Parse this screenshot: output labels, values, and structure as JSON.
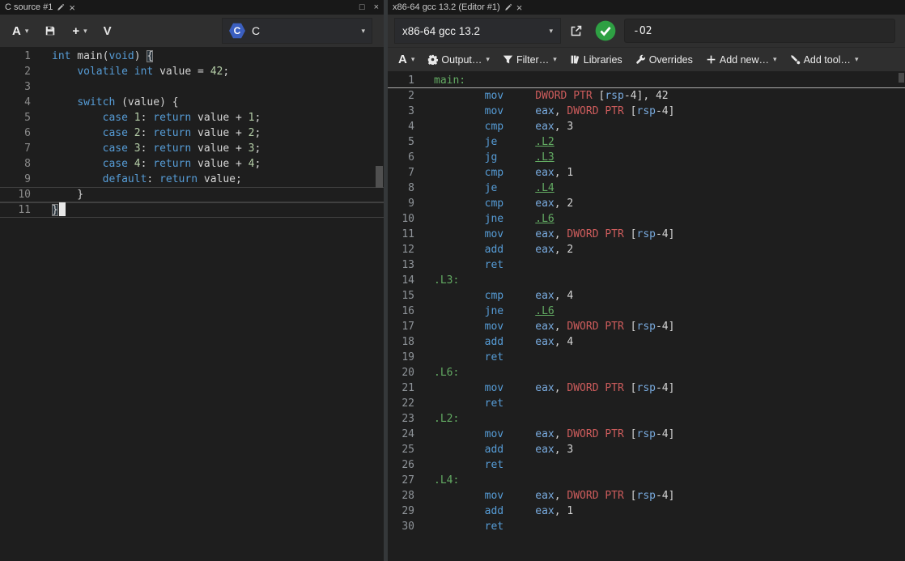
{
  "source_pane": {
    "tab": {
      "title": "C source #1",
      "close_glyph": "×",
      "maximize_glyph": "□"
    },
    "toolbar": {
      "font_label": "A",
      "add_label": "+",
      "vim_label": "V",
      "language_label": "C",
      "language_logo_letter": "C"
    },
    "code_lines": [
      {
        "n": "1",
        "tokens": [
          [
            "kw",
            "int"
          ],
          [
            "pl",
            " main("
          ],
          [
            "kw",
            "void"
          ],
          [
            "pl",
            ") "
          ],
          [
            "bh",
            "{"
          ]
        ]
      },
      {
        "n": "2",
        "tokens": [
          [
            "pl",
            "    "
          ],
          [
            "kw",
            "volatile"
          ],
          [
            "pl",
            " "
          ],
          [
            "kw",
            "int"
          ],
          [
            "pl",
            " value = "
          ],
          [
            "num",
            "42"
          ],
          [
            "pl",
            ";"
          ]
        ]
      },
      {
        "n": "3",
        "tokens": []
      },
      {
        "n": "4",
        "tokens": [
          [
            "pl",
            "    "
          ],
          [
            "kw",
            "switch"
          ],
          [
            "pl",
            " (value) {"
          ]
        ]
      },
      {
        "n": "5",
        "tokens": [
          [
            "pl",
            "        "
          ],
          [
            "kw",
            "case"
          ],
          [
            "pl",
            " "
          ],
          [
            "num",
            "1"
          ],
          [
            "pl",
            ": "
          ],
          [
            "kw",
            "return"
          ],
          [
            "pl",
            " value + "
          ],
          [
            "num",
            "1"
          ],
          [
            "pl",
            ";"
          ]
        ]
      },
      {
        "n": "6",
        "tokens": [
          [
            "pl",
            "        "
          ],
          [
            "kw",
            "case"
          ],
          [
            "pl",
            " "
          ],
          [
            "num",
            "2"
          ],
          [
            "pl",
            ": "
          ],
          [
            "kw",
            "return"
          ],
          [
            "pl",
            " value + "
          ],
          [
            "num",
            "2"
          ],
          [
            "pl",
            ";"
          ]
        ]
      },
      {
        "n": "7",
        "tokens": [
          [
            "pl",
            "        "
          ],
          [
            "kw",
            "case"
          ],
          [
            "pl",
            " "
          ],
          [
            "num",
            "3"
          ],
          [
            "pl",
            ": "
          ],
          [
            "kw",
            "return"
          ],
          [
            "pl",
            " value + "
          ],
          [
            "num",
            "3"
          ],
          [
            "pl",
            ";"
          ]
        ]
      },
      {
        "n": "8",
        "tokens": [
          [
            "pl",
            "        "
          ],
          [
            "kw",
            "case"
          ],
          [
            "pl",
            " "
          ],
          [
            "num",
            "4"
          ],
          [
            "pl",
            ": "
          ],
          [
            "kw",
            "return"
          ],
          [
            "pl",
            " value + "
          ],
          [
            "num",
            "4"
          ],
          [
            "pl",
            ";"
          ]
        ]
      },
      {
        "n": "9",
        "tokens": [
          [
            "pl",
            "        "
          ],
          [
            "kw",
            "default"
          ],
          [
            "pl",
            ": "
          ],
          [
            "kw",
            "return"
          ],
          [
            "pl",
            " value;"
          ]
        ]
      },
      {
        "n": "10",
        "cls": "hl",
        "tokens": [
          [
            "pl",
            "    }"
          ]
        ]
      },
      {
        "n": "11",
        "cls": "hl",
        "caret": true,
        "tokens": [
          [
            "bh",
            "}"
          ]
        ]
      }
    ]
  },
  "compiler_pane": {
    "tab": {
      "title": "x86-64 gcc 13.2 (Editor #1)",
      "close_glyph": "×"
    },
    "toolbar": {
      "compiler_name": "x86-64 gcc 13.2",
      "options_value": "-O2",
      "status": "success"
    },
    "toolbar2": [
      {
        "name": "font-size-button",
        "icon": null,
        "label": "A",
        "big": true,
        "caret": true
      },
      {
        "name": "output-button",
        "icon": "gear",
        "label": "Output…",
        "big": false,
        "caret": true
      },
      {
        "name": "filter-button",
        "icon": "filter",
        "label": "Filter…",
        "big": false,
        "caret": true
      },
      {
        "name": "libraries-button",
        "icon": "book",
        "label": "Libraries",
        "big": false,
        "caret": false
      },
      {
        "name": "overrides-button",
        "icon": "wrench",
        "label": "Overrides",
        "big": false,
        "caret": false
      },
      {
        "name": "add-new-button",
        "icon": "plus",
        "label": "Add new…",
        "big": false,
        "caret": true
      },
      {
        "name": "add-tool-button",
        "icon": "tool",
        "label": "Add tool…",
        "big": false,
        "caret": true
      }
    ],
    "asm_lines": [
      {
        "n": "1",
        "cls": "hlb",
        "tokens": [
          [
            "lbl",
            "main:"
          ]
        ]
      },
      {
        "n": "2",
        "tokens": [
          [
            "pl",
            "        "
          ],
          [
            "mn",
            "mov"
          ],
          [
            "pl",
            "     "
          ],
          [
            "ptr",
            "DWORD PTR"
          ],
          [
            "pl",
            " ["
          ],
          [
            "reg",
            "rsp"
          ],
          [
            "pl",
            "-4], 42"
          ]
        ]
      },
      {
        "n": "3",
        "tokens": [
          [
            "pl",
            "        "
          ],
          [
            "mn",
            "mov"
          ],
          [
            "pl",
            "     "
          ],
          [
            "reg",
            "eax"
          ],
          [
            "pl",
            ", "
          ],
          [
            "ptr",
            "DWORD PTR"
          ],
          [
            "pl",
            " ["
          ],
          [
            "reg",
            "rsp"
          ],
          [
            "pl",
            "-4]"
          ]
        ]
      },
      {
        "n": "4",
        "tokens": [
          [
            "pl",
            "        "
          ],
          [
            "mn",
            "cmp"
          ],
          [
            "pl",
            "     "
          ],
          [
            "reg",
            "eax"
          ],
          [
            "pl",
            ", 3"
          ]
        ]
      },
      {
        "n": "5",
        "tokens": [
          [
            "pl",
            "        "
          ],
          [
            "mn",
            "je"
          ],
          [
            "pl",
            "      "
          ],
          [
            "ref",
            ".L2"
          ]
        ]
      },
      {
        "n": "6",
        "tokens": [
          [
            "pl",
            "        "
          ],
          [
            "mn",
            "jg"
          ],
          [
            "pl",
            "      "
          ],
          [
            "ref",
            ".L3"
          ]
        ]
      },
      {
        "n": "7",
        "tokens": [
          [
            "pl",
            "        "
          ],
          [
            "mn",
            "cmp"
          ],
          [
            "pl",
            "     "
          ],
          [
            "reg",
            "eax"
          ],
          [
            "pl",
            ", 1"
          ]
        ]
      },
      {
        "n": "8",
        "tokens": [
          [
            "pl",
            "        "
          ],
          [
            "mn",
            "je"
          ],
          [
            "pl",
            "      "
          ],
          [
            "ref",
            ".L4"
          ]
        ]
      },
      {
        "n": "9",
        "tokens": [
          [
            "pl",
            "        "
          ],
          [
            "mn",
            "cmp"
          ],
          [
            "pl",
            "     "
          ],
          [
            "reg",
            "eax"
          ],
          [
            "pl",
            ", 2"
          ]
        ]
      },
      {
        "n": "10",
        "tokens": [
          [
            "pl",
            "        "
          ],
          [
            "mn",
            "jne"
          ],
          [
            "pl",
            "     "
          ],
          [
            "ref",
            ".L6"
          ]
        ]
      },
      {
        "n": "11",
        "tokens": [
          [
            "pl",
            "        "
          ],
          [
            "mn",
            "mov"
          ],
          [
            "pl",
            "     "
          ],
          [
            "reg",
            "eax"
          ],
          [
            "pl",
            ", "
          ],
          [
            "ptr",
            "DWORD PTR"
          ],
          [
            "pl",
            " ["
          ],
          [
            "reg",
            "rsp"
          ],
          [
            "pl",
            "-4]"
          ]
        ]
      },
      {
        "n": "12",
        "tokens": [
          [
            "pl",
            "        "
          ],
          [
            "mn",
            "add"
          ],
          [
            "pl",
            "     "
          ],
          [
            "reg",
            "eax"
          ],
          [
            "pl",
            ", 2"
          ]
        ]
      },
      {
        "n": "13",
        "tokens": [
          [
            "pl",
            "        "
          ],
          [
            "mn",
            "ret"
          ]
        ]
      },
      {
        "n": "14",
        "tokens": [
          [
            "lbl",
            ".L3:"
          ]
        ]
      },
      {
        "n": "15",
        "tokens": [
          [
            "pl",
            "        "
          ],
          [
            "mn",
            "cmp"
          ],
          [
            "pl",
            "     "
          ],
          [
            "reg",
            "eax"
          ],
          [
            "pl",
            ", 4"
          ]
        ]
      },
      {
        "n": "16",
        "tokens": [
          [
            "pl",
            "        "
          ],
          [
            "mn",
            "jne"
          ],
          [
            "pl",
            "     "
          ],
          [
            "ref",
            ".L6"
          ]
        ]
      },
      {
        "n": "17",
        "tokens": [
          [
            "pl",
            "        "
          ],
          [
            "mn",
            "mov"
          ],
          [
            "pl",
            "     "
          ],
          [
            "reg",
            "eax"
          ],
          [
            "pl",
            ", "
          ],
          [
            "ptr",
            "DWORD PTR"
          ],
          [
            "pl",
            " ["
          ],
          [
            "reg",
            "rsp"
          ],
          [
            "pl",
            "-4]"
          ]
        ]
      },
      {
        "n": "18",
        "tokens": [
          [
            "pl",
            "        "
          ],
          [
            "mn",
            "add"
          ],
          [
            "pl",
            "     "
          ],
          [
            "reg",
            "eax"
          ],
          [
            "pl",
            ", 4"
          ]
        ]
      },
      {
        "n": "19",
        "tokens": [
          [
            "pl",
            "        "
          ],
          [
            "mn",
            "ret"
          ]
        ]
      },
      {
        "n": "20",
        "tokens": [
          [
            "lbl",
            ".L6:"
          ]
        ]
      },
      {
        "n": "21",
        "tokens": [
          [
            "pl",
            "        "
          ],
          [
            "mn",
            "mov"
          ],
          [
            "pl",
            "     "
          ],
          [
            "reg",
            "eax"
          ],
          [
            "pl",
            ", "
          ],
          [
            "ptr",
            "DWORD PTR"
          ],
          [
            "pl",
            " ["
          ],
          [
            "reg",
            "rsp"
          ],
          [
            "pl",
            "-4]"
          ]
        ]
      },
      {
        "n": "22",
        "tokens": [
          [
            "pl",
            "        "
          ],
          [
            "mn",
            "ret"
          ]
        ]
      },
      {
        "n": "23",
        "tokens": [
          [
            "lbl",
            ".L2:"
          ]
        ]
      },
      {
        "n": "24",
        "tokens": [
          [
            "pl",
            "        "
          ],
          [
            "mn",
            "mov"
          ],
          [
            "pl",
            "     "
          ],
          [
            "reg",
            "eax"
          ],
          [
            "pl",
            ", "
          ],
          [
            "ptr",
            "DWORD PTR"
          ],
          [
            "pl",
            " ["
          ],
          [
            "reg",
            "rsp"
          ],
          [
            "pl",
            "-4]"
          ]
        ]
      },
      {
        "n": "25",
        "tokens": [
          [
            "pl",
            "        "
          ],
          [
            "mn",
            "add"
          ],
          [
            "pl",
            "     "
          ],
          [
            "reg",
            "eax"
          ],
          [
            "pl",
            ", 3"
          ]
        ]
      },
      {
        "n": "26",
        "tokens": [
          [
            "pl",
            "        "
          ],
          [
            "mn",
            "ret"
          ]
        ]
      },
      {
        "n": "27",
        "tokens": [
          [
            "lbl",
            ".L4:"
          ]
        ]
      },
      {
        "n": "28",
        "tokens": [
          [
            "pl",
            "        "
          ],
          [
            "mn",
            "mov"
          ],
          [
            "pl",
            "     "
          ],
          [
            "reg",
            "eax"
          ],
          [
            "pl",
            ", "
          ],
          [
            "ptr",
            "DWORD PTR"
          ],
          [
            "pl",
            " ["
          ],
          [
            "reg",
            "rsp"
          ],
          [
            "pl",
            "-4]"
          ]
        ]
      },
      {
        "n": "29",
        "tokens": [
          [
            "pl",
            "        "
          ],
          [
            "mn",
            "add"
          ],
          [
            "pl",
            "     "
          ],
          [
            "reg",
            "eax"
          ],
          [
            "pl",
            ", 1"
          ]
        ]
      },
      {
        "n": "30",
        "tokens": [
          [
            "pl",
            "        "
          ],
          [
            "mn",
            "ret"
          ]
        ]
      }
    ]
  },
  "colors": {
    "keyword": "#569cd6",
    "number": "#b5cea8",
    "register": "#79abdf",
    "pointer_directive": "#cd5c5c",
    "label": "#63ab63",
    "status_ok": "#2ea043",
    "editor_bg": "#1e1e1e",
    "toolbar_bg": "#2f2f2f"
  }
}
